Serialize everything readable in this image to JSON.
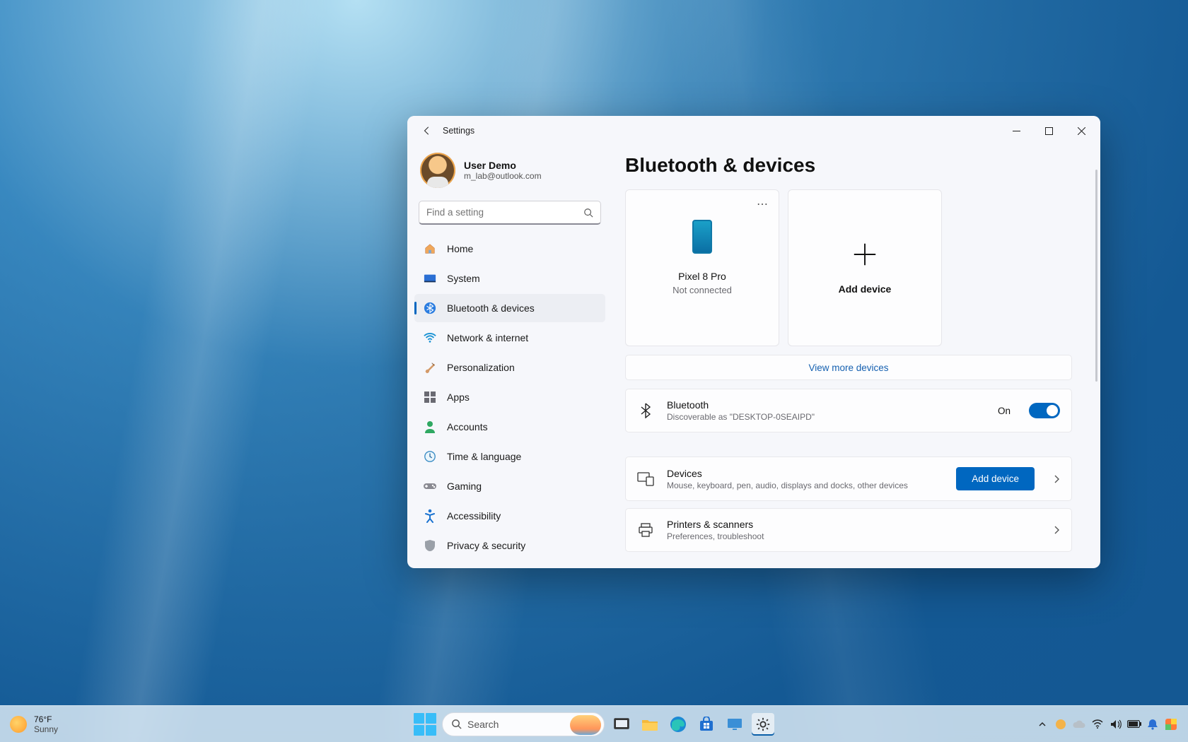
{
  "window": {
    "title": "Settings",
    "page_title": "Bluetooth & devices"
  },
  "user": {
    "name": "User Demo",
    "email": "m_lab@outlook.com"
  },
  "search": {
    "placeholder": "Find a setting"
  },
  "nav": {
    "home": "Home",
    "system": "System",
    "bluetooth": "Bluetooth & devices",
    "network": "Network & internet",
    "personalization": "Personalization",
    "apps": "Apps",
    "accounts": "Accounts",
    "time": "Time & language",
    "gaming": "Gaming",
    "accessibility": "Accessibility",
    "privacy": "Privacy & security"
  },
  "device_card": {
    "name": "Pixel 8 Pro",
    "status": "Not connected"
  },
  "add_card": {
    "label": "Add device"
  },
  "view_more": "View more devices",
  "bluetooth_row": {
    "title": "Bluetooth",
    "subtitle": "Discoverable as \"DESKTOP-0SEAIPD\"",
    "state_label": "On"
  },
  "devices_row": {
    "title": "Devices",
    "subtitle": "Mouse, keyboard, pen, audio, displays and docks, other devices",
    "button": "Add device"
  },
  "printers_row": {
    "title": "Printers & scanners",
    "subtitle": "Preferences, troubleshoot"
  },
  "taskbar": {
    "temp": "76°F",
    "cond": "Sunny",
    "search_placeholder": "Search"
  }
}
